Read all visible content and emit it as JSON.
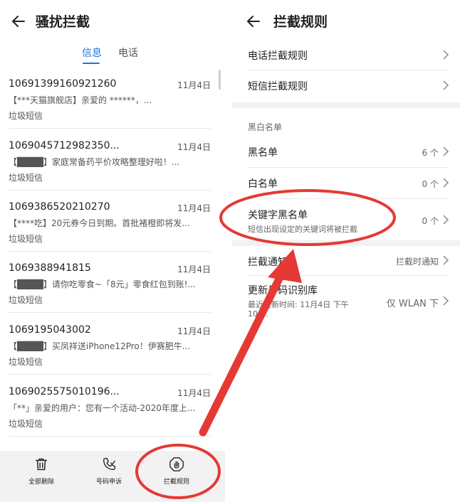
{
  "left": {
    "title": "骚扰拦截",
    "tabs": [
      "信息",
      "电话"
    ],
    "messages": [
      {
        "number": "10691399160921260",
        "date": "11月4日",
        "preview": "【***天猫旗舰店】亲爱的 ******，...",
        "tag": "垃圾短信"
      },
      {
        "number": "1069045712982350...",
        "date": "11月4日",
        "preview": "【████】家庭常备药平价攻略整理好啦！...",
        "tag": "垃圾短信"
      },
      {
        "number": "1069386520210270",
        "date": "11月4日",
        "preview": "【****吃】20元券今日到期。首批褚橙即将发...",
        "tag": "垃圾短信"
      },
      {
        "number": "1069388941815",
        "date": "11月4日",
        "preview": "【████】请你吃零食~「8元」零食红包到账!...",
        "tag": "垃圾短信"
      },
      {
        "number": "1069195043002",
        "date": "11月4日",
        "preview": "【████】买凤祥送iPhone12Pro！伊赛肥牛...",
        "tag": "垃圾短信"
      },
      {
        "number": "1069025575010196...",
        "date": "11月4日",
        "preview": "「**」亲爱的用户：您有一个活动-2020年度上...",
        "tag": "垃圾短信"
      }
    ],
    "bottom_bar": [
      "全部删除",
      "号码申诉",
      "拦截规则"
    ]
  },
  "right": {
    "title": "拦截规则",
    "rows": {
      "phone_rules": "电话拦截规则",
      "sms_rules": "短信拦截规则",
      "section_lists": "黑白名单",
      "blacklist": "黑名单",
      "blacklist_count": "6 个",
      "whitelist": "白名单",
      "whitelist_count": "0 个",
      "keyword_blacklist": "关键字黑名单",
      "keyword_blacklist_desc": "短信出现设定的关键词将被拦截",
      "keyword_blacklist_count": "0 个",
      "intercept_notify": "拦截通知",
      "intercept_notify_value": "拦截时通知",
      "update_db": "更新号码识别库",
      "update_db_desc": "最近更新时间: 11月4日 下午",
      "update_db_desc2": "10:…",
      "update_db_value": "仅 WLAN 下"
    }
  },
  "colors": {
    "accent": "#1a73e8",
    "annotation": "#e53935",
    "divider": "#e8e8e8",
    "band": "#f2f2f2"
  },
  "icons": [
    "back-arrow-icon",
    "trash-icon",
    "phone-appeal-icon",
    "shield-hand-icon",
    "chevron-right-icon"
  ]
}
